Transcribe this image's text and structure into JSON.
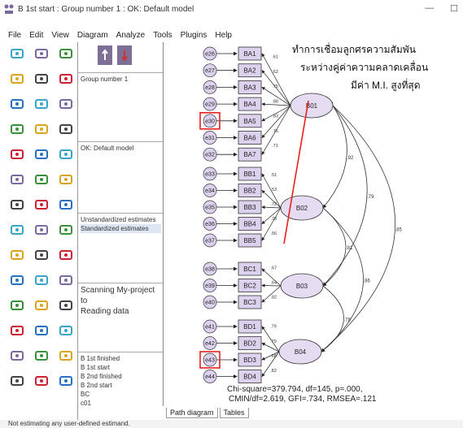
{
  "window": {
    "title": "B 1st start : Group number 1 : OK: Default model"
  },
  "menu": [
    "File",
    "Edit",
    "View",
    "Diagram",
    "Analyze",
    "Tools",
    "Plugins",
    "Help"
  ],
  "panels": {
    "groups": "Group number 1",
    "models": "OK: Default model",
    "estimates": [
      "Unstandardized estimates",
      "Standardized estimates"
    ],
    "messages": [
      "Scanning My-project to",
      "Reading data"
    ],
    "files": [
      "B 1st finished",
      "B 1st start",
      "B 2nd finished",
      "B 2nd start",
      "BC",
      "c01"
    ]
  },
  "annotation": {
    "line1": "ทำการเชื่อมลูกศรความสัมพัน",
    "line2": "ระหว่างคู่ค่าความคลาดเคลื่อน",
    "line3": "มีค่า M.I. สูงที่สุด"
  },
  "fit": {
    "line1": "Chi-square=379.794, df=145, p=.000,",
    "line2": "CMIN/df=2.619, GFI=.734, RMSEA=.121"
  },
  "tabs": [
    "Path diagram",
    "Tables"
  ],
  "status": "Not estimating any user-defined estimand.",
  "model": {
    "latent": [
      "B01",
      "B02",
      "B03",
      "B04"
    ],
    "indicators": [
      "BA1",
      "BA2",
      "BA3",
      "BA4",
      "BA5",
      "BA6",
      "BA7",
      "BB1",
      "BB2",
      "BB3",
      "BB4",
      "BB5",
      "BC1",
      "BC2",
      "BC3",
      "BD1",
      "BD2",
      "BD3",
      "BD4"
    ],
    "errors": [
      "e26",
      "e27",
      "e28",
      "e29",
      "e30",
      "e31",
      "e32",
      "e33",
      "e34",
      "e35",
      "e36",
      "e37",
      "e38",
      "e39",
      "e40",
      "e41",
      "e42",
      "e43",
      "e44"
    ],
    "loadings": [
      ".61",
      ".62",
      ".75",
      ".88",
      ".83",
      ".76",
      ".71",
      ".51",
      ".53",
      ".72",
      ".78",
      ".56",
      ".67",
      ".64",
      ".82",
      ".79",
      ".79",
      ".68",
      ".82"
    ],
    "correlations": [
      ".92",
      ".79",
      ".85",
      ".81",
      ".86",
      ".78"
    ],
    "highlighted_errors": [
      "e30",
      "e43"
    ],
    "colors": {
      "latent_fill": "#e6dcf2",
      "box_fill": "#ddd2ee",
      "highlight": "#e8201e",
      "annotation_line": "#e8201e"
    }
  }
}
